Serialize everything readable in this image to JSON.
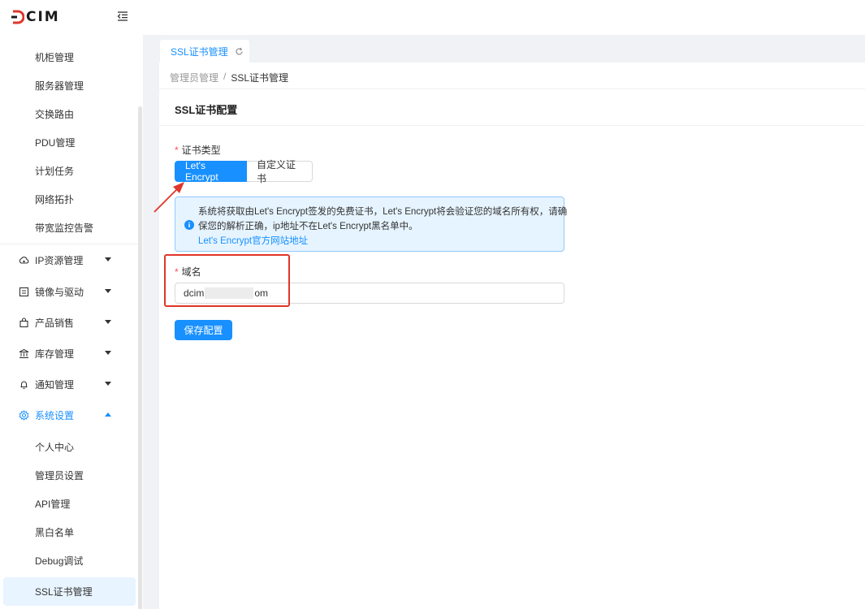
{
  "header": {
    "logo_text": "CIM",
    "logo_accent": "#e0362b",
    "collapse_icon": "menu-fold-icon"
  },
  "sidebar": {
    "top_items": [
      {
        "label": "机柜管理"
      },
      {
        "label": "服务器管理"
      },
      {
        "label": "交换路由"
      },
      {
        "label": "PDU管理"
      },
      {
        "label": "计划任务"
      },
      {
        "label": "网络拓扑"
      },
      {
        "label": "带宽监控告警"
      }
    ],
    "groups": [
      {
        "label": "IP资源管理",
        "icon": "cloud-icon"
      },
      {
        "label": "镜像与驱动",
        "icon": "image-icon"
      },
      {
        "label": "产品销售",
        "icon": "shopping-bag-icon"
      },
      {
        "label": "库存管理",
        "icon": "bank-icon"
      },
      {
        "label": "通知管理",
        "icon": "bell-icon"
      },
      {
        "label": "系统设置",
        "icon": "gear-icon"
      }
    ],
    "settings_items": [
      {
        "label": "个人中心"
      },
      {
        "label": "管理员设置"
      },
      {
        "label": "API管理"
      },
      {
        "label": "黑白名单"
      },
      {
        "label": "Debug调试"
      },
      {
        "label": "SSL证书管理"
      }
    ]
  },
  "tabs": [
    {
      "label": "SSL证书管理",
      "icon": "refresh-icon"
    }
  ],
  "breadcrumb": {
    "parent": "管理员管理",
    "separator": "/",
    "current": "SSL证书管理"
  },
  "section": {
    "title": "SSL证书配置"
  },
  "form": {
    "cert_type_label": "证书类型",
    "required_mark": "*",
    "cert_type_options": [
      "Let's Encrypt",
      "自定义证书"
    ],
    "cert_type_selected": "Let's Encrypt",
    "alert_line1": "系统将获取由Let's Encrypt签发的免费证书，Let's Encrypt将会验证您的域名所有权，请确",
    "alert_line2": "保您的解析正确，ip地址不在Let's Encrypt黑名单中。",
    "alert_link": "Let's Encrypt官方网站地址",
    "domain_label": "域名",
    "domain_value_start": "dcim",
    "domain_value_end": "om",
    "save_label": "保存配置"
  },
  "colors": {
    "primary": "#1890ff",
    "annotation": "#e0362b",
    "alert_bg": "#e6f4ff",
    "active_menu_bg": "#e8f4ff"
  }
}
